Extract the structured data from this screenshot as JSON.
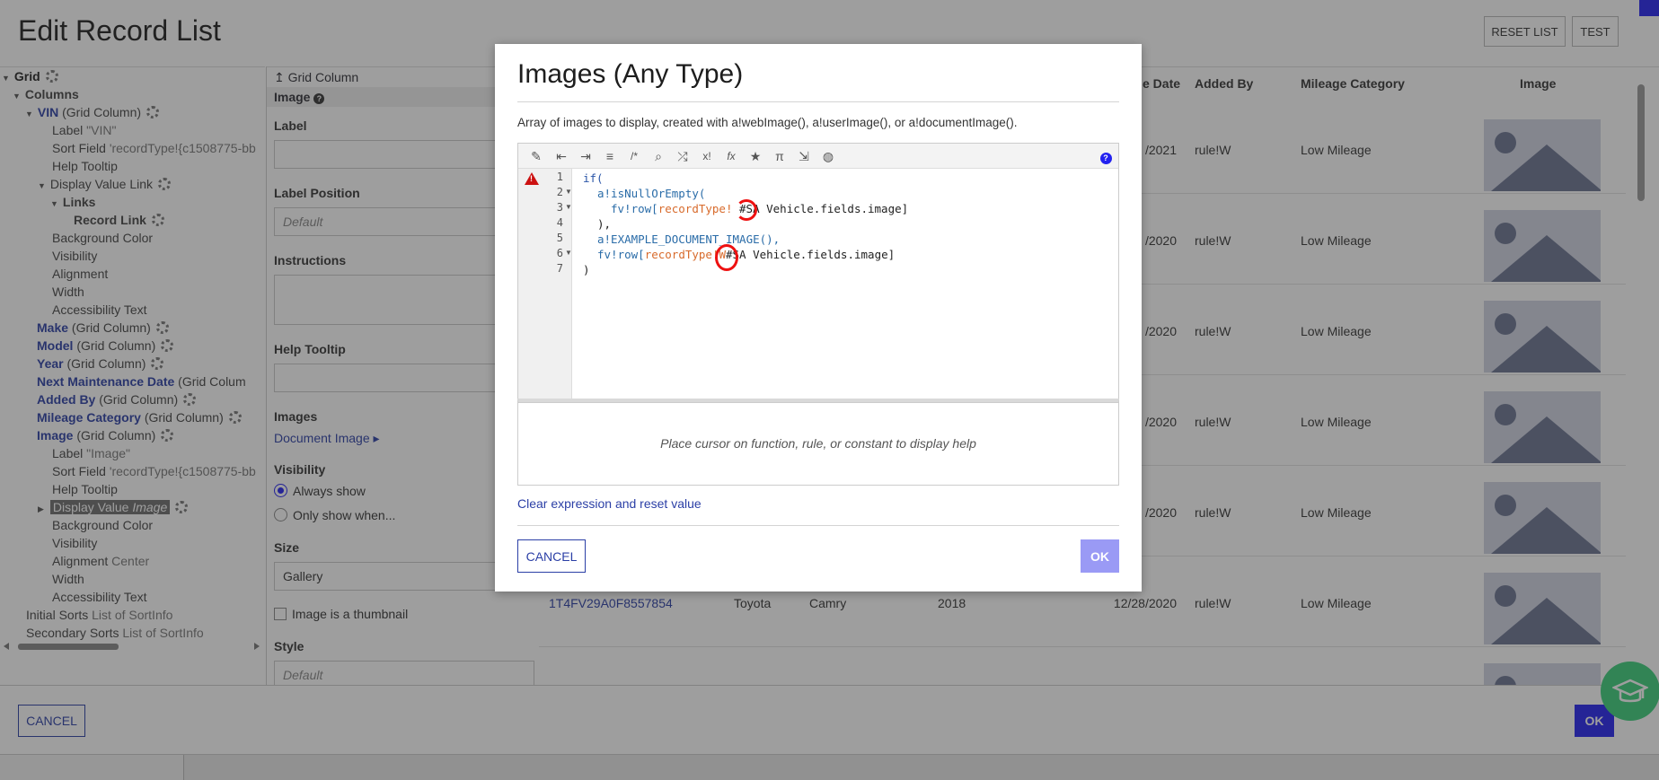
{
  "page": {
    "title": "Edit Record List",
    "reset_list": "RESET LIST",
    "test": "TEST"
  },
  "tree": {
    "grid": "Grid",
    "columns": "Columns",
    "vin": "VIN",
    "grid_column": "(Grid Column)",
    "label_vin_key": "Label",
    "label_vin_val": "\"VIN\"",
    "sort_field_key": "Sort Field",
    "sort_field_val": "'recordType!{c1508775-bb",
    "help_tooltip": "Help Tooltip",
    "display_value_link": "Display Value Link",
    "links": "Links",
    "record_link": "Record Link",
    "background_color": "Background Color",
    "visibility": "Visibility",
    "alignment": "Alignment",
    "width": "Width",
    "accessibility_text": "Accessibility Text",
    "make": "Make",
    "model": "Model",
    "year": "Year",
    "next_maintenance": "Next Maintenance Date",
    "next_maintenance_suffix": "(Grid Colum",
    "added_by": "Added By",
    "mileage_category": "Mileage Category",
    "image": "Image",
    "label_image_val": "\"Image\"",
    "display_value": "Display Value",
    "display_value_type": "Image",
    "alignment_val": "Center",
    "initial_sorts": "Initial Sorts",
    "secondary_sorts": "Secondary Sorts",
    "list_of_sortinfo": "List of SortInfo"
  },
  "props": {
    "breadcrumb": "Grid Column",
    "header": "Image",
    "label": "Label",
    "label_position": "Label Position",
    "label_position_placeholder": "Default",
    "instructions": "Instructions",
    "help_tooltip": "Help Tooltip",
    "images": "Images",
    "images_value": "Document Image",
    "visibility": "Visibility",
    "always_show": "Always show",
    "only_show_when": "Only show when...",
    "size": "Size",
    "size_value": "Gallery",
    "thumbnail_label": "Image is a thumbnail",
    "style": "Style",
    "style_placeholder": "Default"
  },
  "grid": {
    "headers": [
      "e Date",
      "Added By",
      "Mileage Category",
      "Image"
    ],
    "rows": [
      {
        "date": "/2021",
        "added_by": "rule!W",
        "mileage": "Low Mileage"
      },
      {
        "date": "/2020",
        "added_by": "rule!W",
        "mileage": "Low Mileage"
      },
      {
        "date": "/2020",
        "added_by": "rule!W",
        "mileage": "Low Mileage"
      },
      {
        "date": "/2020",
        "added_by": "rule!W",
        "mileage": "Low Mileage"
      },
      {
        "date": "/2020",
        "added_by": "rule!W",
        "mileage": "Low Mileage"
      },
      {
        "vin": "1T4FV29A0F8557854",
        "make": "Toyota",
        "model": "Camry",
        "year": "2018",
        "date": "12/28/2020",
        "added_by": "rule!W",
        "mileage": "Low Mileage"
      }
    ]
  },
  "footer": {
    "cancel": "CANCEL",
    "ok": "OK"
  },
  "dialog": {
    "title": "Images (Any Type)",
    "description": "Array of images to display, created with a!webImage(), a!userImage(), or a!documentImage().",
    "line_numbers": [
      "1",
      "2",
      "3",
      "4",
      "5",
      "6",
      "7"
    ],
    "code": {
      "l1": "if(",
      "l2": "a!isNullOrEmpty(",
      "l3_a": "fv!row[",
      "l3_b": "recordType!",
      "l3_c": "#SA Vehicle.fields.image]",
      "l4": "),",
      "l5": "a!EXAMPLE_DOCUMENT_IMAGE(),",
      "l6_a": "fv!row[",
      "l6_b": "recordType!W",
      "l6_c": "#SA Vehicle.fields.image]",
      "l7": ")"
    },
    "help_placeholder": "Place cursor on function, rule, or constant to display help",
    "clear_link": "Clear expression and reset value",
    "cancel": "CANCEL",
    "ok": "OK"
  },
  "colors": {
    "accent": "#2322f0",
    "link": "#2b3fa6",
    "error_circle": "#e11111",
    "help_fab": "#3bd07b"
  }
}
